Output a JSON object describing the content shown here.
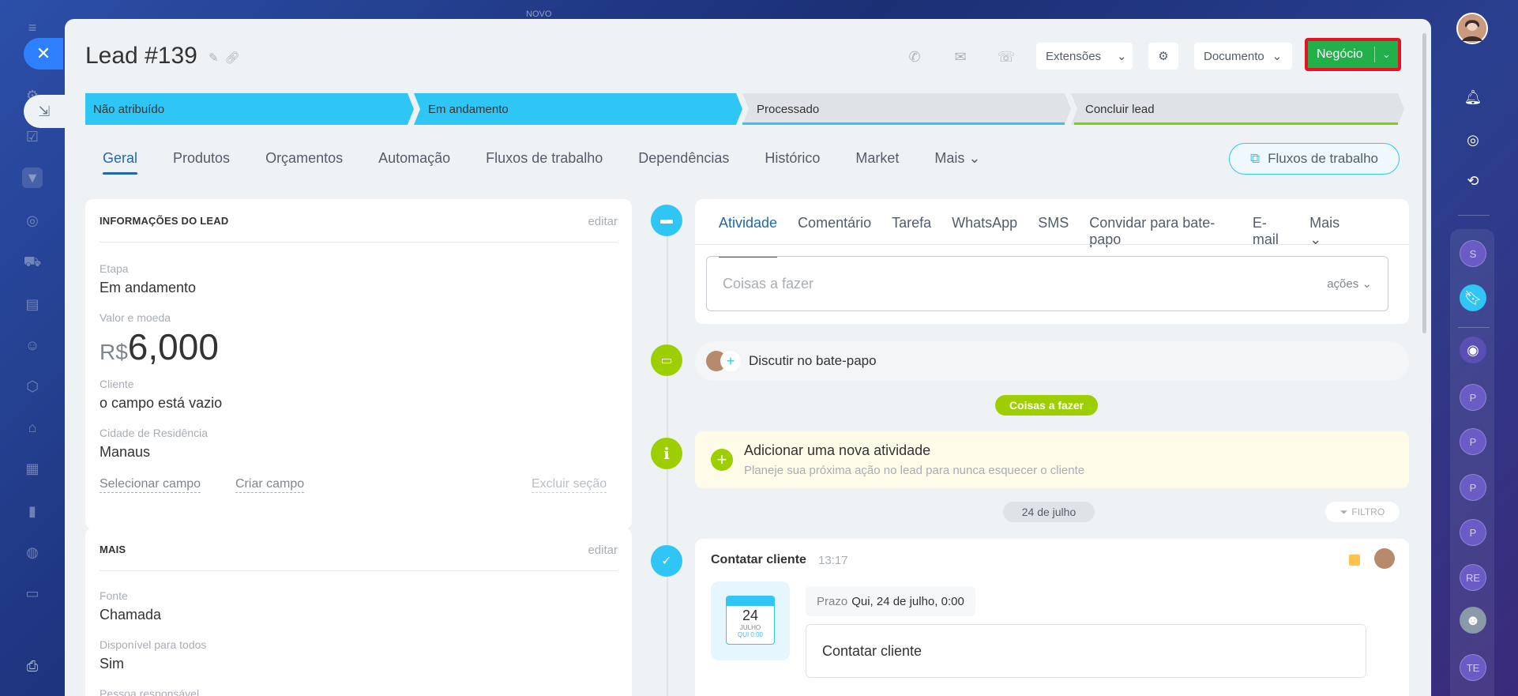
{
  "window": {
    "top_label": "NOVO"
  },
  "lead": {
    "title": "Lead #139"
  },
  "header": {
    "extensions": "Extensões",
    "document": "Documento",
    "primary": "Negócio"
  },
  "stages": [
    "Não atribuído",
    "Em andamento",
    "Processado",
    "Concluir lead"
  ],
  "tabs": [
    "Geral",
    "Produtos",
    "Orçamentos",
    "Automação",
    "Fluxos de trabalho",
    "Dependências",
    "Histórico",
    "Market"
  ],
  "tabs_more": "Mais",
  "flow_button": "Fluxos de trabalho",
  "lead_info": {
    "header": "INFORMAÇÕES DO LEAD",
    "edit": "editar",
    "stage_label": "Etapa",
    "stage_value": "Em andamento",
    "money_label": "Valor e moeda",
    "currency": "R$",
    "amount": "6,000",
    "client_label": "Cliente",
    "client_value": "o campo está vazio",
    "city_label": "Cidade de Residência",
    "city_value": "Manaus",
    "select_field": "Selecionar campo",
    "create_field": "Criar campo",
    "delete_section": "Excluir seção"
  },
  "more_info": {
    "header": "MAIS",
    "edit": "editar",
    "source_label": "Fonte",
    "source_value": "Chamada",
    "available_label": "Disponível para todos",
    "available_value": "Sim",
    "responsible_label": "Pessoa responsável"
  },
  "activity": {
    "tabs": [
      "Atividade",
      "Comentário",
      "Tarefa",
      "WhatsApp",
      "SMS",
      "Convidar para bate-papo",
      "E-mail"
    ],
    "more": "Mais",
    "placeholder": "Coisas a fazer",
    "actions": "ações"
  },
  "chat": {
    "label": "Discutir no bate-papo"
  },
  "todo_badge": "Coisas a fazer",
  "add_activity": {
    "title": "Adicionar uma nova atividade",
    "subtitle": "Planeje sua próxima ação no lead para nunca esquecer o cliente"
  },
  "date_badge": "24 de julho",
  "filter": "FILTRO",
  "task": {
    "title": "Contatar cliente",
    "time": "13:17",
    "cal_day": "24",
    "cal_month": "JULHO",
    "cal_sub": "QUI 0:00",
    "deadline_label": "Prazo",
    "deadline_value": "Qui, 24 de julho, 0:00",
    "body": "Contatar cliente"
  },
  "right_rail": {
    "letters": [
      "S",
      "P",
      "P",
      "P",
      "P",
      "RE",
      "TE"
    ]
  },
  "colors": {
    "accent_blue": "#2fc6f6",
    "link_blue": "#2067b0",
    "primary_green": "#21b04a",
    "highlight_red": "#e81224",
    "timeline_green": "#9dcf00"
  }
}
